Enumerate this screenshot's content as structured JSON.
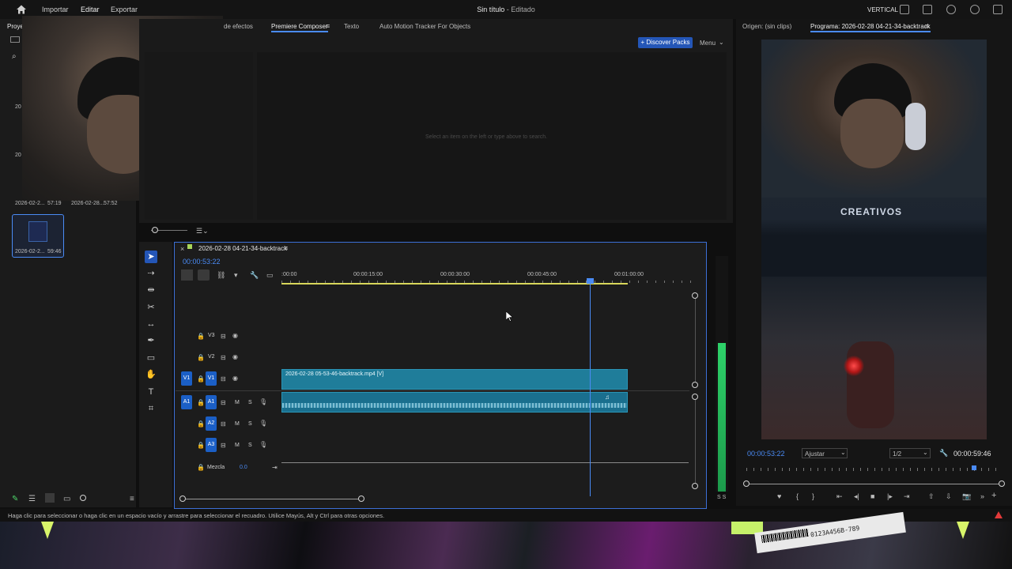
{
  "menu": {
    "import": "Importar",
    "edit": "Editar",
    "export": "Exportar"
  },
  "title": {
    "name": "Sin título",
    "suffix": " - Editado"
  },
  "top_right": {
    "layout": "VERTICAL"
  },
  "left_panel": {
    "tab": "Proye",
    "items": [
      {
        "label": "2026-02-2...",
        "duration": "57:19"
      },
      {
        "label": "2026-02-28...",
        "duration": "57:52"
      },
      {
        "label": "2026-02-2...",
        "duration": "59:46"
      }
    ],
    "year_a": "20",
    "year_b": "20"
  },
  "source_tabs": {
    "effects": "de efectos",
    "composer": "Premiere Composer",
    "text": "Texto",
    "tracker": "Auto Motion Tracker For Objects",
    "discover": "Discover Packs",
    "menu": "Menu",
    "empty_msg": "Select an item on the left or type above to search."
  },
  "timeline": {
    "sequence_name": "2026-02-28 04-21-34-backtrack",
    "timecode": "00:00:53:22",
    "ruler": [
      ":00:00",
      "00:00:15:00",
      "00:00:30:00",
      "00:00:45:00",
      "00:01:00:00"
    ],
    "video_clip": "2026-02-28 05-53-46-backtrack.mp4 [V]",
    "tracks": {
      "v3": "V3",
      "v2": "V2",
      "v1": "V1",
      "a1": "A1",
      "a2": "A2",
      "a3": "A3",
      "mix": "Mezcla",
      "mix_value": "0.0",
      "m": "M",
      "s": "S"
    }
  },
  "program": {
    "source_label": "Origen: (sin clips)",
    "program_label": "Programa: 2026-02-28 04-21-34-backtrack",
    "timecode": "00:00:53:22",
    "fit": "Ajustar",
    "resolution": "1/2",
    "duration": "00:00:59:46",
    "logo": "CREATIVOS"
  },
  "meter": {
    "level": 0.63,
    "label": "S S"
  },
  "status": {
    "text": "Haga clic para seleccionar o haga clic en un espacio vacío y arrastre para seleccionar el recuadro. Utilice Mayús, Alt y Ctrl para otras opciones."
  },
  "bottom_art": {
    "barcode": "0123A456B-789"
  },
  "colors": {
    "accent": "#2456b7",
    "clip_video": "#1f7d9a",
    "meter": "#2ed36a",
    "warning": "#e23a3a"
  }
}
